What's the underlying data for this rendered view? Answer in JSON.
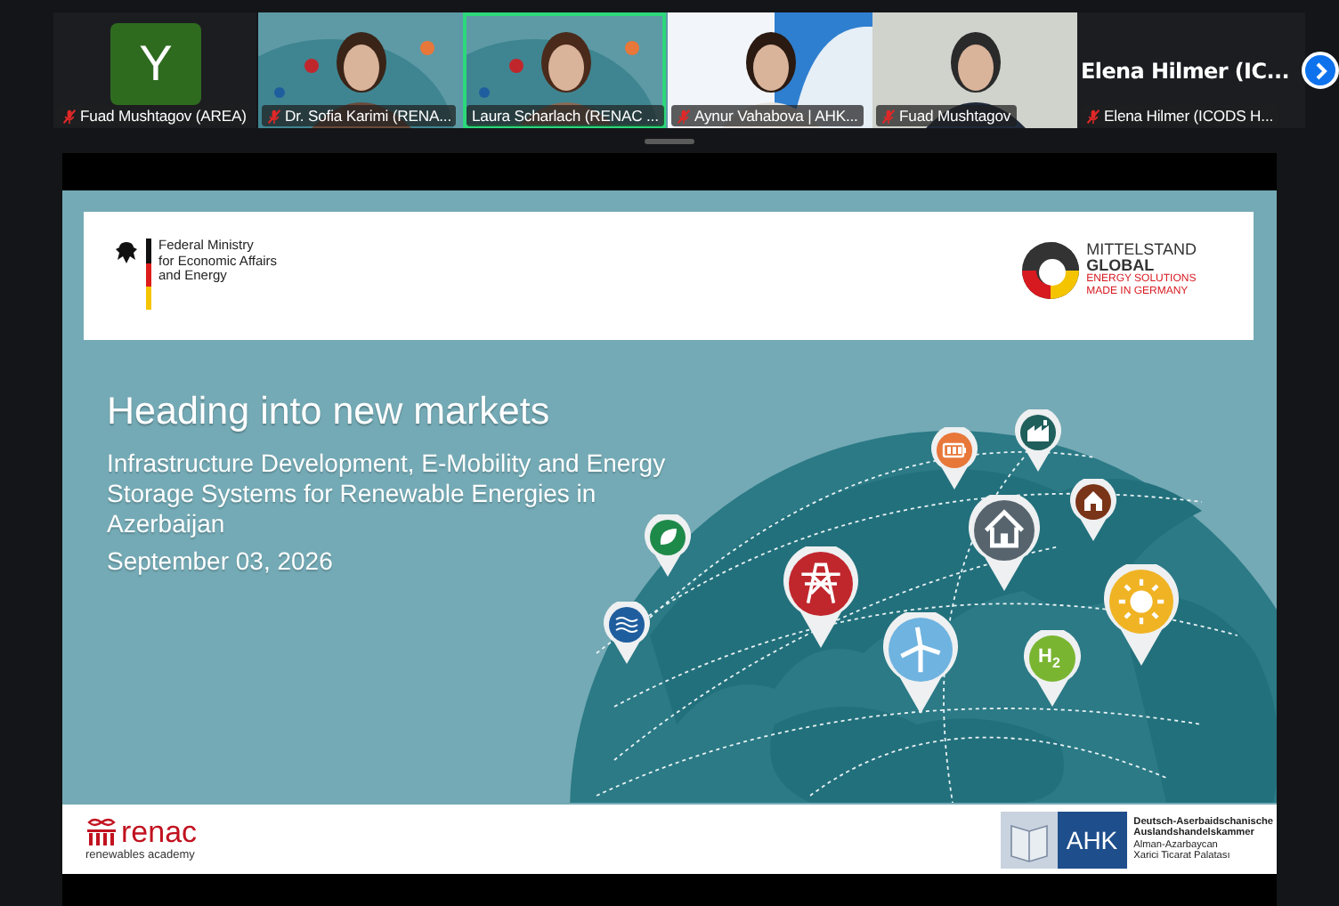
{
  "participants": [
    {
      "kind": "avatar",
      "initial": "Y",
      "label": "Fuad Mushtagov (AREA)",
      "muted": true,
      "speaking": false
    },
    {
      "kind": "video",
      "label": "Dr. Sofia Karimi (RENA...",
      "muted": true,
      "speaking": false
    },
    {
      "kind": "video",
      "label": "Laura Scharlach (RENAC ...",
      "muted": false,
      "speaking": true
    },
    {
      "kind": "video",
      "label": "Aynur Vahabova | AHK...",
      "muted": true,
      "speaking": false
    },
    {
      "kind": "video",
      "label": "Fuad Mushtagov",
      "muted": true,
      "speaking": false
    },
    {
      "kind": "name",
      "display_name": "Elena Hilmer (IC...",
      "label": "Elena Hilmer (ICODS H...",
      "muted": true,
      "speaking": false
    }
  ],
  "slide": {
    "ministry_logo": [
      "Federal Ministry",
      "for Economic Affairs",
      "and Energy"
    ],
    "partner_logo": {
      "name": [
        "MITTELSTAND",
        "GLOBAL"
      ],
      "tagline": [
        "ENERGY SOLUTIONS",
        "MADE IN GERMANY"
      ]
    },
    "title": "Heading into new markets",
    "subtitle": "Infrastructure Development, E-Mobility and Energy Storage Systems for Renewable Energies in Azerbaijan",
    "date": "September 03, 2026",
    "pins": [
      {
        "kind": "battery",
        "color": "#e8773a"
      },
      {
        "kind": "factory",
        "color": "#1f5f5c"
      },
      {
        "kind": "hut",
        "color": "#7a3418"
      },
      {
        "kind": "house",
        "color": "#57646e"
      },
      {
        "kind": "pylon",
        "color": "#c0272d"
      },
      {
        "kind": "sun",
        "color": "#f0b323"
      },
      {
        "kind": "turbine",
        "color": "#6fb3e0"
      },
      {
        "kind": "hydrogen",
        "color": "#7ab532",
        "label": "H$_{2}$"
      },
      {
        "kind": "leaf",
        "color": "#1e8a4a"
      },
      {
        "kind": "water",
        "color": "#1f5e9e"
      }
    ],
    "footer": {
      "renac": {
        "name": "renac",
        "tagline": "renewables academy"
      },
      "ahk": {
        "badge": "AHK",
        "lines": [
          "Deutsch-Aserbaidschanische",
          "Auslandshandelskammer",
          "Alman-Azarbaycan",
          "Xarici Ticarat Palatası"
        ]
      }
    }
  }
}
